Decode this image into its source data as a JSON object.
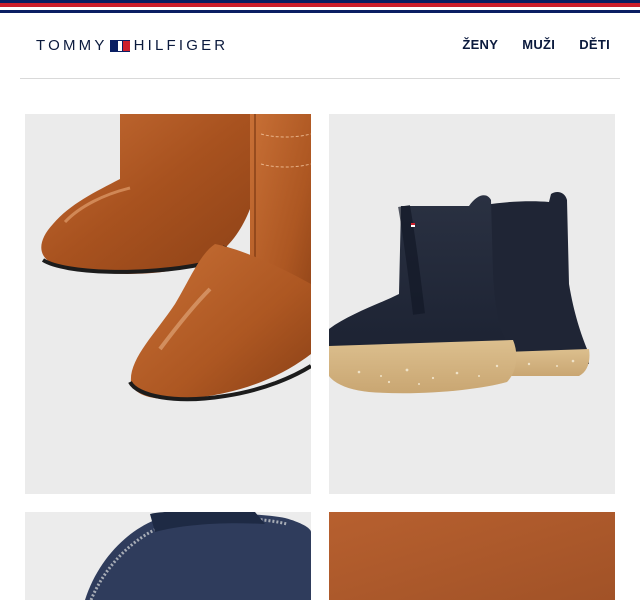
{
  "brand": {
    "logo_left": "TOMMY",
    "logo_right": "HILFIGER",
    "flag_icon": "tommy-flag-icon",
    "colors": {
      "navy": "#0a1f63",
      "red": "#cd1f2c",
      "text": "#0b1a3d"
    }
  },
  "nav": {
    "items": [
      {
        "label": "ŽENY"
      },
      {
        "label": "MUŽI"
      },
      {
        "label": "DĚTI"
      }
    ]
  },
  "tiles": [
    {
      "name": "brown-leather-boots-image"
    },
    {
      "name": "navy-suede-chelsea-boots-image"
    },
    {
      "name": "navy-bag-image"
    },
    {
      "name": "cognac-suede-image"
    }
  ]
}
